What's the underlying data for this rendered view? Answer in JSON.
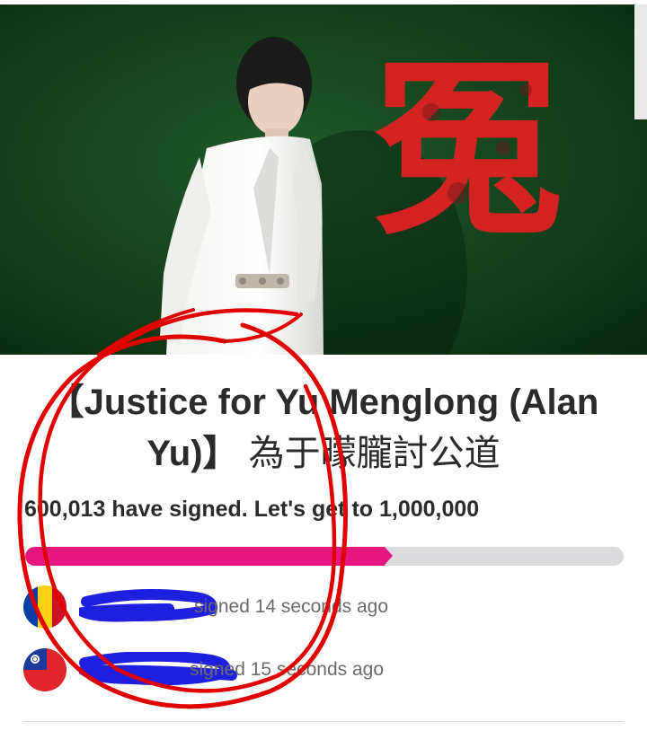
{
  "petition": {
    "title_en": "【Justice for Yu Menglong (Alan Yu)】",
    "title_zh": "為于曚朧討公道",
    "signed_text": "600,013 have signed. Let's get to 1,000,000",
    "signed_count": 600013,
    "goal": 1000000,
    "hero_glyph": "冤"
  },
  "progress": {
    "fraction": 0.6,
    "fill_color": "#e7157f",
    "track_color": "#dcdcdf"
  },
  "recent_signers": [
    {
      "flag": "romania-flag-icon",
      "time_text": "signed 14 seconds ago"
    },
    {
      "flag": "taiwan-flag-icon",
      "time_text": "signed 15 seconds ago"
    }
  ],
  "colors": {
    "hero_background": "#0f3a18",
    "annotation_circle": "#e00000",
    "redaction": "#1f1fe0"
  }
}
